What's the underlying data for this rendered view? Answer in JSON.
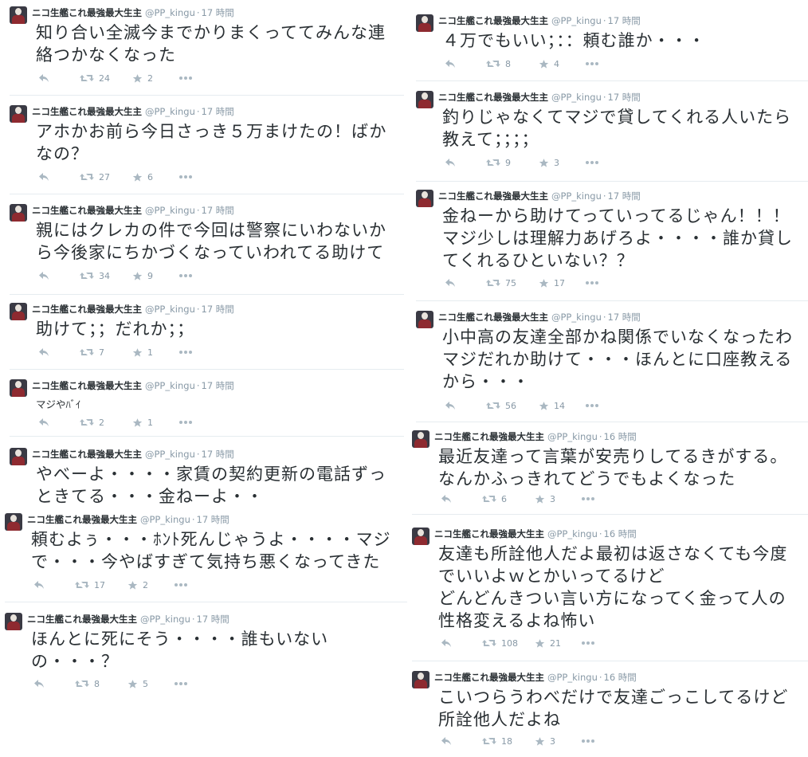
{
  "user": {
    "name": "ニコ生艦これ最強最大生主",
    "handle": "@PP_kingu",
    "sep": "·"
  },
  "tweets": [
    {
      "time": "17 時間",
      "lines": "知り合い全滅今までかりまくっててみんな連\n絡つかなくなった",
      "retweets": "24",
      "favorites": "2"
    },
    {
      "time": "17 時間",
      "lines": "アホかお前ら今日さっき５万まけたの！ばか\nなの？",
      "retweets": "27",
      "favorites": "6"
    },
    {
      "time": "17 時間",
      "lines": "親にはクレカの件で今回は警察にいわないか\nら今後家にちかづくなっていわれてる助けて",
      "retweets": "34",
      "favorites": "9"
    },
    {
      "time": "17 時間",
      "lines": "助けて；；だれか；；",
      "retweets": "7",
      "favorites": "1"
    },
    {
      "time": "17 時間",
      "lines": "マジやﾊﾞｲ",
      "retweets": "2",
      "favorites": "1"
    },
    {
      "time": "17 時間",
      "lines": "やべーよ・・・・家賃の契約更新の電話ずっ\nときてる・・・金ねーよ・・",
      "retweets": "",
      "favorites": ""
    },
    {
      "time": "17 時間",
      "lines": "頼むよぅ・・・ﾎﾝﾄ死んじゃうよ・・・・マジ\nで・・・今やばすぎて気持ち悪くなってきた",
      "retweets": "17",
      "favorites": "2"
    },
    {
      "time": "17 時間",
      "lines": "ほんとに死にそう・・・・誰もいない\nの・・・？",
      "retweets": "8",
      "favorites": "5"
    },
    {
      "time": "17 時間",
      "lines": "４万でもいい；：：頼む誰か・・・",
      "retweets": "8",
      "favorites": "4"
    },
    {
      "time": "17 時間",
      "lines": "釣りじゃなくてマジで貸してくれる人いたら\n教えて；；；；",
      "retweets": "9",
      "favorites": "3"
    },
    {
      "time": "17 時間",
      "lines": "金ねーから助けてっていってるじゃん！！！\nマジ少しは理解力あげろよ・・・・誰か貸し\nてくれるひといない？？",
      "retweets": "75",
      "favorites": "17"
    },
    {
      "time": "17 時間",
      "lines": "小中高の友達全部かね関係でいなくなったわ\nマジだれか助けて・・・ほんとに口座教える\nから・・・",
      "retweets": "56",
      "favorites": "14"
    },
    {
      "time": "16 時間",
      "lines": "最近友達って言葉が安売りしてるきがする。\nなんかふっきれてどうでもよくなった",
      "retweets": "6",
      "favorites": "3"
    },
    {
      "time": "16 時間",
      "lines": "友達も所詮他人だよ最初は返さなくても今度\nでいいよｗとかいってるけど\nどんどんきつい言い方になってく金って人の\n性格変えるよね怖い",
      "retweets": "108",
      "favorites": "21"
    },
    {
      "time": "16 時間",
      "lines": "こいつらうわべだけで友達ごっこしてるけど\n所詮他人だよね",
      "retweets": "18",
      "favorites": "3"
    }
  ]
}
